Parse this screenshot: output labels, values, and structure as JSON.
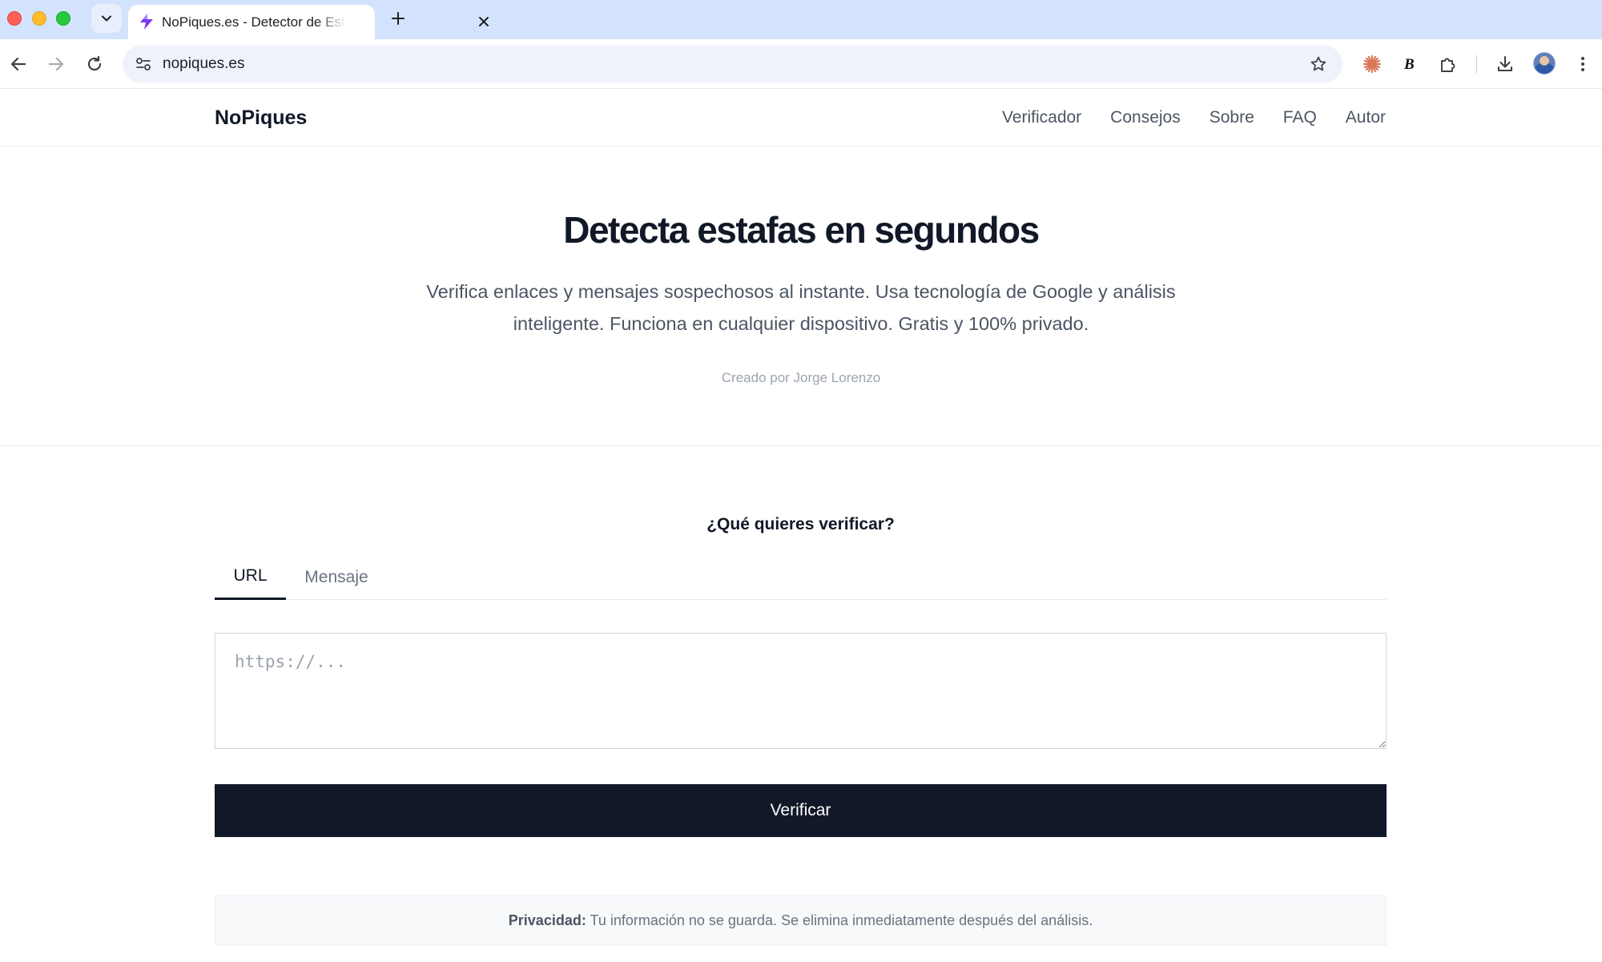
{
  "browser": {
    "tab_title": "NoPiques.es - Detector de Estafas",
    "url": "nopiques.es"
  },
  "site": {
    "brand": "NoPiques",
    "nav": [
      "Verificador",
      "Consejos",
      "Sobre",
      "FAQ",
      "Autor"
    ]
  },
  "hero": {
    "title": "Detecta estafas en segundos",
    "subtitle": "Verifica enlaces y mensajes sospechosos al instante. Usa tecnología de Google y análisis inteligente. Funciona en cualquier dispositivo. Gratis y 100% privado.",
    "credit": "Creado por Jorge Lorenzo"
  },
  "verifier": {
    "heading": "¿Qué quieres verificar?",
    "tabs": [
      "URL",
      "Mensaje"
    ],
    "input_placeholder": "https://...",
    "button_label": "Verificar"
  },
  "privacy": {
    "label": "Privacidad:",
    "text": " Tu información no se guarda. Se elimina inmediatamente después del análisis."
  },
  "icons": {
    "favicon": "purple-bolt-icon",
    "extension_1": "claude-sunburst-icon",
    "extension_2": "bold-b-icon"
  },
  "colors": {
    "chrome_tabstrip": "#d3e3fd",
    "primary_dark": "#111827",
    "muted_text": "#6b7280",
    "favicon_purple": "#7c3aed"
  }
}
